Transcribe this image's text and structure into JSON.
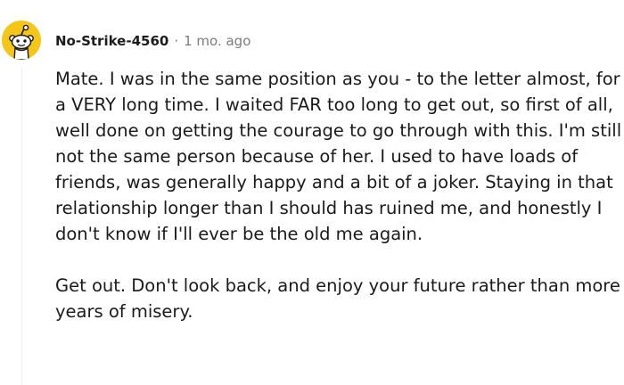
{
  "comment": {
    "author": "No-Strike-4560",
    "separator": "·",
    "time": "1 mo. ago",
    "paragraphs": [
      "Mate. I was in the same position as you - to the letter almost, for a VERY long time. I waited FAR too long to get out, so first of all, well done on getting the courage to go through with this. I'm still not the same person because of her. I used to have loads of friends, was generally happy and a bit of a joker. Staying in that relationship longer than I should has ruined me, and honestly I don't know if I'll ever be the old me again.",
      "Get out. Don't look back, and enjoy your future rather than more years of misery."
    ]
  },
  "colors": {
    "avatar_bg": "#f5c518",
    "snoo_body": "#ffffff",
    "snoo_outline": "#1a1a1b",
    "text": "#1a1a1b",
    "meta": "#7c7c7c",
    "thread_line": "#edeff1"
  },
  "icons": {
    "avatar": "reddit-snoo-avatar-icon"
  }
}
